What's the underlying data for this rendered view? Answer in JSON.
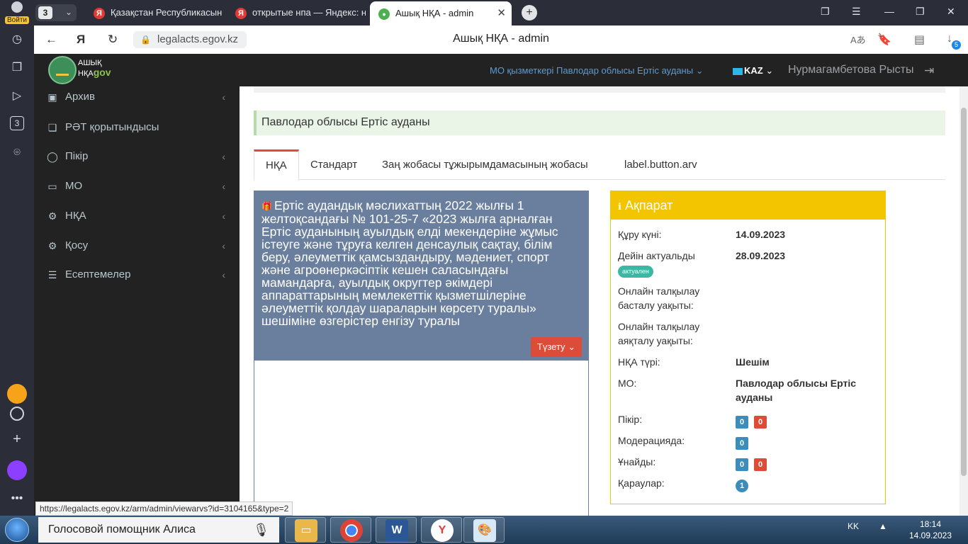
{
  "browser": {
    "tab_count": "3",
    "login_label": "Войти",
    "tabs": [
      {
        "label": "Қазақстан Республикасын",
        "fav": "Я",
        "color": "#e53935"
      },
      {
        "label": "открытые нпа — Яндекс: н",
        "fav": "Я",
        "color": "#e53935"
      },
      {
        "label": "Ашық НҚА - admin",
        "fav": "●",
        "color": "#4caf50"
      }
    ],
    "url": "legalacts.egov.kz",
    "page_title": "Ашық НҚА - admin",
    "downloads_count": "5",
    "status_url": "https://legalacts.egov.kz/arm/admin/viewarvs?id=3104165&type=2"
  },
  "header": {
    "logo_line1": "АШЫҚ",
    "logo_line2": "НҚА",
    "logo_gov": "gov",
    "org": "МО қызметкері Павлодар облысы Ертіс ауданы",
    "lang": "KAZ",
    "user": "Нурмагамбетова Рысты"
  },
  "sidebar": {
    "items": [
      {
        "label": "Архив",
        "icon": "archive-icon"
      },
      {
        "label": "РӘТ қорытындысы",
        "icon": "document-icon"
      },
      {
        "label": "Пікір",
        "icon": "comment-icon"
      },
      {
        "label": "МО",
        "icon": "briefcase-icon"
      },
      {
        "label": "НҚА",
        "icon": "gear-icon"
      },
      {
        "label": "Қосу",
        "icon": "gear-icon"
      },
      {
        "label": "Есептемелер",
        "icon": "list-icon"
      }
    ]
  },
  "main": {
    "region": "Павлодар облысы Ертіс ауданы",
    "tabs": [
      "НҚА",
      "Стандарт",
      "Заң жобасы тұжырымдамасының жобасы",
      "label.button.arv"
    ],
    "doc_title": "Ертіс аудандық мәслихаттың 2022 жылғы 1 желтоқсандағы № 101-25-7 «2023 жылға арналған Ертіс ауданының ауылдық елді мекендеріне жұмыс істеуге және тұруға келген денсаулық сақтау, білім беру, әлеуметтік қамсыздандыру, мәдениет, спорт және агроөнеркәсіптік кешен саласындағы мамандарға, ауылдық округтер әкімдері аппараттарының мемлекеттік қызметшілеріне әлеуметтік қолдау шараларын көрсету туралы» шешіміне өзгерістер енгізу туралы",
    "edit_label": "Түзету"
  },
  "info": {
    "title": "Ақпарат",
    "created_label": "Құру күні:",
    "created_value": "14.09.2023",
    "until_label": "Дейін актуальды",
    "until_value": "28.09.2023",
    "status_tag": "актуален",
    "online_start_label": "Онлайн талқылау басталу уақыты:",
    "online_end_label": "Онлайн талқылау аяқталу уақыты:",
    "type_label": "НҚА түрі:",
    "type_value": "Шешім",
    "mo_label": "МО:",
    "mo_value": "Павлодар облысы Ертіс ауданы",
    "opinion_label": "Пікір:",
    "opinion_blue": "0",
    "opinion_red": "0",
    "moderation_label": "Модерацияда:",
    "moderation_blue": "0",
    "likes_label": "Ұнайды:",
    "likes_blue": "0",
    "likes_red": "0",
    "views_label": "Қараулар:",
    "views_value": "1"
  },
  "taskbar": {
    "alisa": "Голосовой помощник Алиса",
    "lang": "KK",
    "time": "18:14",
    "date": "14.09.2023"
  }
}
